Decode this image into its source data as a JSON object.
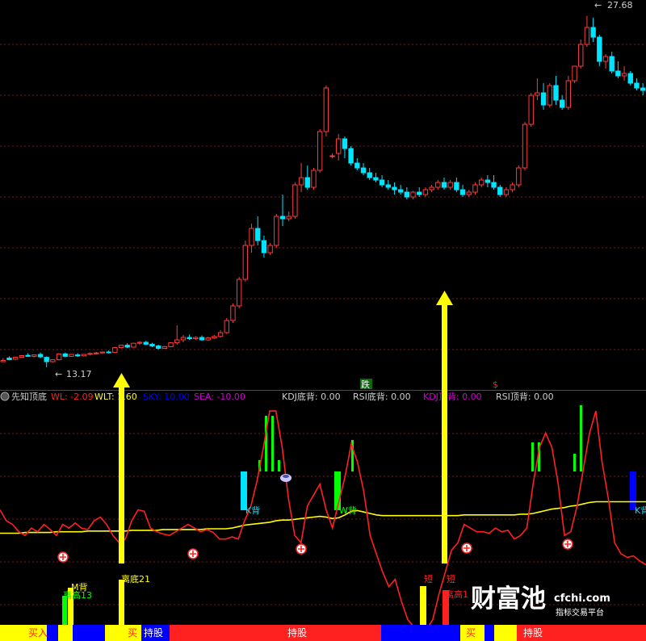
{
  "chart_data": [
    {
      "type": "candlestick",
      "title": "",
      "price_high_label": "27.68",
      "price_low_label": "13.17",
      "ylim": [
        12.6,
        28.2
      ],
      "up_color": "#ff3c3c",
      "down_color": "#00e5ff",
      "candles": [
        [
          13.4,
          13.55,
          13.45,
          13.38
        ],
        [
          13.55,
          13.62,
          13.48,
          13.52
        ],
        [
          13.5,
          13.55,
          13.58,
          13.47
        ],
        [
          13.58,
          13.66,
          13.65,
          13.56
        ],
        [
          13.66,
          13.75,
          13.62,
          13.6
        ],
        [
          13.62,
          13.7,
          13.68,
          13.58
        ],
        [
          13.7,
          13.78,
          13.6,
          13.55
        ],
        [
          13.58,
          13.62,
          13.4,
          13.17
        ],
        [
          13.4,
          13.5,
          13.48,
          13.36
        ],
        [
          13.48,
          13.75,
          13.72,
          13.45
        ],
        [
          13.72,
          13.78,
          13.62,
          13.58
        ],
        [
          13.62,
          13.72,
          13.7,
          13.6
        ],
        [
          13.68,
          13.75,
          13.64,
          13.6
        ],
        [
          13.64,
          13.72,
          13.7,
          13.62
        ],
        [
          13.7,
          13.78,
          13.74,
          13.66
        ],
        [
          13.74,
          13.8,
          13.76,
          13.7
        ],
        [
          13.76,
          13.82,
          13.8,
          13.72
        ],
        [
          13.8,
          13.86,
          13.78,
          13.74
        ],
        [
          13.78,
          14.0,
          13.98,
          13.76
        ],
        [
          13.98,
          14.1,
          14.08,
          13.94
        ],
        [
          14.08,
          14.16,
          14.0,
          13.96
        ],
        [
          14.0,
          14.18,
          14.16,
          13.98
        ],
        [
          14.16,
          14.25,
          14.2,
          14.1
        ],
        [
          14.2,
          14.26,
          14.12,
          14.08
        ],
        [
          14.12,
          14.18,
          14.05,
          14.0
        ],
        [
          14.05,
          14.1,
          13.95,
          13.9
        ],
        [
          13.95,
          14.05,
          14.02,
          13.92
        ],
        [
          14.02,
          14.2,
          14.18,
          14.0
        ],
        [
          14.18,
          14.9,
          14.3,
          14.1
        ],
        [
          14.3,
          14.5,
          14.4,
          14.2
        ],
        [
          14.4,
          14.52,
          14.35,
          14.3
        ],
        [
          14.35,
          14.45,
          14.4,
          14.3
        ],
        [
          14.4,
          14.48,
          14.3,
          14.26
        ],
        [
          14.3,
          14.42,
          14.38,
          14.26
        ],
        [
          14.38,
          14.5,
          14.44,
          14.34
        ],
        [
          14.44,
          14.7,
          14.6,
          14.4
        ],
        [
          14.6,
          15.2,
          15.1,
          14.55
        ],
        [
          15.1,
          15.8,
          15.7,
          15.0
        ],
        [
          15.7,
          16.9,
          16.8,
          15.6
        ],
        [
          16.8,
          18.4,
          18.2,
          16.7
        ],
        [
          18.2,
          19.1,
          18.9,
          17.9
        ],
        [
          18.9,
          19.4,
          18.4,
          18.2
        ],
        [
          18.4,
          18.6,
          17.9,
          17.7
        ],
        [
          17.9,
          18.3,
          18.2,
          17.8
        ],
        [
          18.2,
          19.5,
          19.4,
          18.1
        ],
        [
          19.4,
          20.3,
          19.3,
          19.0
        ],
        [
          19.3,
          19.6,
          19.4,
          19.2
        ],
        [
          19.4,
          20.8,
          20.7,
          19.3
        ],
        [
          20.7,
          21.6,
          21.0,
          20.4
        ],
        [
          21.0,
          21.5,
          20.6,
          20.5
        ],
        [
          20.6,
          21.4,
          21.3,
          20.5
        ],
        [
          21.3,
          23.0,
          22.9,
          21.2
        ],
        [
          22.9,
          24.8,
          24.7,
          22.7
        ],
        [
          21.9,
          22.0,
          21.9,
          21.8
        ],
        [
          22.0,
          22.8,
          22.6,
          21.7
        ],
        [
          22.6,
          22.7,
          22.2,
          21.8
        ],
        [
          22.2,
          22.3,
          21.6,
          21.5
        ],
        [
          21.6,
          21.8,
          21.4,
          21.3
        ],
        [
          21.4,
          21.6,
          21.2,
          21.1
        ],
        [
          21.2,
          21.4,
          21.0,
          20.9
        ],
        [
          21.0,
          21.2,
          20.9,
          20.8
        ],
        [
          20.9,
          21.1,
          20.7,
          20.6
        ],
        [
          20.7,
          20.9,
          20.6,
          20.5
        ],
        [
          20.6,
          20.8,
          20.5,
          20.3
        ],
        [
          20.5,
          20.7,
          20.4,
          20.3
        ],
        [
          20.4,
          20.6,
          20.2,
          20.1
        ],
        [
          20.2,
          20.45,
          20.4,
          20.1
        ],
        [
          20.4,
          20.6,
          20.3,
          20.2
        ],
        [
          20.3,
          20.6,
          20.5,
          20.2
        ],
        [
          20.5,
          20.7,
          20.6,
          20.4
        ],
        [
          20.6,
          20.9,
          20.8,
          20.5
        ],
        [
          20.8,
          21.0,
          20.6,
          20.5
        ],
        [
          20.6,
          20.9,
          20.8,
          20.5
        ],
        [
          20.8,
          21.0,
          20.5,
          20.4
        ],
        [
          20.5,
          20.7,
          20.3,
          20.2
        ],
        [
          20.3,
          20.5,
          20.4,
          20.2
        ],
        [
          20.4,
          20.8,
          20.7,
          20.3
        ],
        [
          20.7,
          21.0,
          20.9,
          20.6
        ],
        [
          20.9,
          21.1,
          20.8,
          20.6
        ],
        [
          20.8,
          21.1,
          20.6,
          20.5
        ],
        [
          20.6,
          20.7,
          20.3,
          20.2
        ],
        [
          20.3,
          20.6,
          20.5,
          20.2
        ],
        [
          20.5,
          20.8,
          20.7,
          20.4
        ],
        [
          20.7,
          21.5,
          21.4,
          20.6
        ],
        [
          21.4,
          23.3,
          23.2,
          21.3
        ],
        [
          23.2,
          24.5,
          24.4,
          23.1
        ],
        [
          24.4,
          25.1,
          24.5,
          24.2
        ],
        [
          24.5,
          24.9,
          24.0,
          23.8
        ],
        [
          24.0,
          24.9,
          24.8,
          23.9
        ],
        [
          24.8,
          25.2,
          24.2,
          24.0
        ],
        [
          24.2,
          24.4,
          23.9,
          23.8
        ],
        [
          23.9,
          25.2,
          25.0,
          23.8
        ],
        [
          25.0,
          25.5,
          25.6,
          24.9
        ],
        [
          25.6,
          26.7,
          26.5,
          25.5
        ],
        [
          26.5,
          27.68,
          27.2,
          26.4
        ],
        [
          27.2,
          27.6,
          26.8,
          26.6
        ],
        [
          26.8,
          26.9,
          25.8,
          25.6
        ],
        [
          25.8,
          26.1,
          26.0,
          25.5
        ],
        [
          26.0,
          26.2,
          25.4,
          25.3
        ],
        [
          25.4,
          25.8,
          25.2,
          25.1
        ],
        [
          25.2,
          25.6,
          25.3,
          25.0
        ],
        [
          25.3,
          25.4,
          24.9,
          24.8
        ],
        [
          24.9,
          25.1,
          24.7,
          24.6
        ],
        [
          24.7,
          24.9,
          24.6,
          24.4
        ]
      ]
    },
    {
      "type": "line",
      "title": "先知顶底",
      "legend": [
        {
          "label": "WL: -2.09",
          "color": "#ff2020"
        },
        {
          "label": "WLT: 1.60",
          "color": "#ffff00"
        },
        {
          "label": "SKY: 10.00",
          "color": "#0000ff"
        },
        {
          "label": "SEA: -10.00",
          "color": "#d000d0"
        },
        {
          "label": "KDJ底背: 0.00",
          "color": "#cfcfcf"
        },
        {
          "label": "RSI底背: 0.00",
          "color": "#cfcfcf"
        },
        {
          "label": "KDJ顶背: 0.00",
          "color": "#d000d0"
        },
        {
          "label": "RSI顶背: 0.00",
          "color": "#cfcfcf"
        }
      ],
      "ylim": [
        -15,
        15
      ],
      "series": [
        {
          "name": "WL",
          "color": "#ff2020",
          "values": [
            0.5,
            -1.0,
            -1.5,
            -2.5,
            -3.0,
            -2.0,
            -2.5,
            -1.5,
            -2.2,
            -3.0,
            -1.5,
            -2.0,
            -1.3,
            -2.0,
            -2.2,
            -1.0,
            -0.5,
            -1.5,
            -3.0,
            -4.0,
            -3.5,
            -1.0,
            0.5,
            0.3,
            -2.0,
            -2.5,
            -2.8,
            -3.0,
            -2.5,
            -2.0,
            -1.5,
            -2.0,
            -2.5,
            -2.2,
            -2.6,
            -3.5,
            -3.5,
            -3.2,
            -3.5,
            -1.0,
            1.0,
            4.5,
            9.0,
            14.0,
            14.0,
            9.0,
            2.0,
            -3.0,
            -4.0,
            1.0,
            2.5,
            4.0,
            0.5,
            -2.0,
            1.5,
            5.0,
            9.5,
            7.0,
            3.0,
            -3.0,
            -5.5,
            -8.0,
            -10.0,
            -9.0,
            -12.0,
            -14.5,
            -15.5,
            -15.8,
            -15.8,
            -14.5,
            -11.0,
            -8.0,
            -5.0,
            -4.0,
            -1.5,
            -2.0,
            -2.5,
            -2.5,
            -2.7,
            -2.0,
            -2.5,
            -2.3,
            -3.5,
            -3.0,
            -2.0,
            4.0,
            9.0,
            11.0,
            9.0,
            4.0,
            -3.0,
            -2.5,
            1.0,
            6.0,
            11.0,
            14.0,
            7.0,
            2.0,
            -4.0,
            -5.5,
            -6.0,
            -5.8,
            -6.5,
            -7.0
          ]
        },
        {
          "name": "WLT",
          "color": "#ffff00",
          "values": [
            -2.7,
            -2.7,
            -2.7,
            -2.7,
            -2.6,
            -2.6,
            -2.6,
            -2.6,
            -2.6,
            -2.5,
            -2.5,
            -2.5,
            -2.5,
            -2.5,
            -2.4,
            -2.4,
            -2.4,
            -2.4,
            -2.4,
            -2.4,
            -2.4,
            -2.3,
            -2.3,
            -2.3,
            -2.3,
            -2.3,
            -2.2,
            -2.2,
            -2.2,
            -2.2,
            -2.2,
            -2.2,
            -2.2,
            -2.1,
            -2.1,
            -2.1,
            -2.1,
            -2.0,
            -1.8,
            -1.6,
            -1.5,
            -1.4,
            -1.3,
            -1.2,
            -1.0,
            -0.9,
            -0.9,
            -0.8,
            -0.7,
            -0.6,
            -0.5,
            -0.4,
            -0.5,
            -0.7,
            -0.6,
            -0.2,
            0.3,
            0.4,
            0.2,
            0.0,
            -0.2,
            -0.3,
            -0.3,
            -0.3,
            -0.3,
            -0.3,
            -0.3,
            -0.3,
            -0.3,
            -0.3,
            -0.3,
            -0.3,
            -0.3,
            -0.3,
            -0.2,
            -0.2,
            -0.2,
            -0.2,
            -0.2,
            -0.2,
            -0.2,
            -0.2,
            -0.2,
            -0.1,
            -0.1,
            0.0,
            0.2,
            0.4,
            0.6,
            0.7,
            0.8,
            1.0,
            1.1,
            1.3,
            1.5,
            1.6,
            1.6,
            1.6,
            1.6,
            1.6,
            1.6,
            1.6,
            1.6,
            1.6
          ]
        }
      ],
      "signals": [
        {
          "label": "M背",
          "color": "#ffff00"
        },
        {
          "label": "离高13",
          "color": "#00ff00"
        },
        {
          "label": "离底21",
          "color": "#ffff00"
        },
        {
          "label": "K背",
          "color": "#00e5ff"
        },
        {
          "label": "W背",
          "color": "#00ff00"
        },
        {
          "label": "短",
          "color": "#ff2020"
        },
        {
          "label": "短",
          "color": "#ff2020"
        },
        {
          "label": "离高1",
          "color": "#ff2020"
        },
        {
          "label": "K背",
          "color": "#00e5ff"
        }
      ]
    }
  ],
  "markers": {
    "fall": "跌",
    "dollar": "$"
  },
  "status_bar": [
    {
      "label": "买入",
      "color": "#ffff00",
      "text_color": "#ff2020"
    },
    {
      "label": "买",
      "color": "#ffff00",
      "text_color": "#ff2020"
    },
    {
      "label": "持股",
      "color": "#ff2020",
      "text_color": "#ffffff"
    },
    {
      "label": "持股",
      "color": "#ff2020",
      "text_color": "#ffffff"
    },
    {
      "label": "买",
      "color": "#ffff00",
      "text_color": "#ff2020"
    },
    {
      "label": "持股",
      "color": "#ff2020",
      "text_color": "#ffffff"
    }
  ],
  "watermark": {
    "brand": "财富池",
    "site": "cfchi.com",
    "tagline": "指标交易平台"
  }
}
